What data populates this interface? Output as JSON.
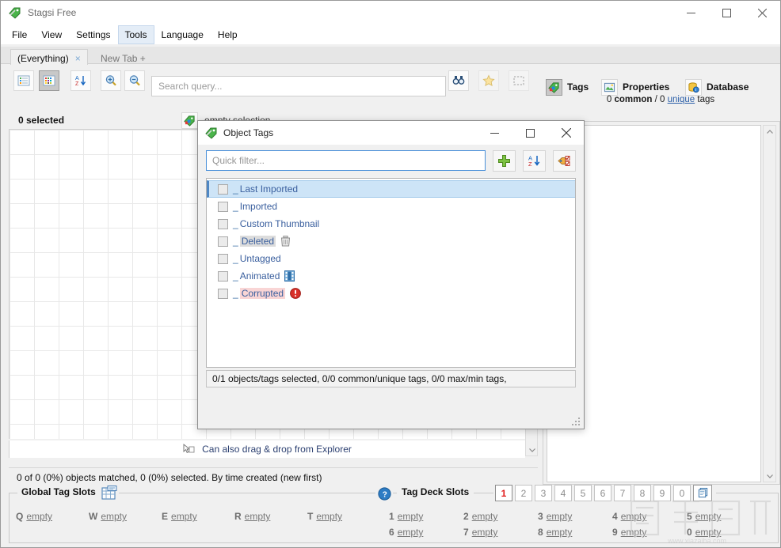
{
  "window": {
    "title": "Stagsi Free",
    "icon": "tag-icon",
    "minimize": "—",
    "maximize": "☐",
    "close": "✕"
  },
  "menubar": {
    "items": [
      {
        "label": "File",
        "active": false
      },
      {
        "label": "View",
        "active": false
      },
      {
        "label": "Settings",
        "active": false
      },
      {
        "label": "Tools",
        "active": true
      },
      {
        "label": "Language",
        "active": false
      },
      {
        "label": "Help",
        "active": false
      }
    ]
  },
  "tabs": {
    "selected": "(Everything)",
    "close_glyph": "×",
    "new_tab": "New Tab +"
  },
  "toolbar": {
    "buttons": [
      {
        "name": "list-view-icon",
        "pressed": false
      },
      {
        "name": "grid-view-icon",
        "pressed": true
      },
      {
        "name": "sort-az-icon",
        "pressed": false
      },
      {
        "name": "zoom-in-icon",
        "pressed": false
      },
      {
        "name": "zoom-out-icon",
        "pressed": false
      }
    ],
    "search_placeholder": "Search query...",
    "search_value": "",
    "binoculars": "find-icon",
    "favorite": "star-icon",
    "select_region": "marquee-icon"
  },
  "right_panel": {
    "tabs": [
      {
        "label": "Tags",
        "icon": "tags-icon",
        "active": true
      },
      {
        "label": "Properties",
        "icon": "properties-icon",
        "active": false
      },
      {
        "label": "Database",
        "icon": "database-icon",
        "active": false
      }
    ],
    "counts": {
      "common_value": "0",
      "common_label": "common",
      "separator": "/",
      "unique_value": "0",
      "unique_label": "unique",
      "suffix": "tags"
    }
  },
  "selection_header": {
    "count": "0 selected",
    "icon": "tags-icon",
    "empty_label": "empty selection"
  },
  "drag_drop": {
    "icon": "drag-drop-icon",
    "label": "Can also drag & drop from Explorer"
  },
  "statusbar": {
    "text": "0 of 0 (0%) objects matched, 0 (0%) selected. By time created (new first)"
  },
  "global_tag_slots": {
    "title": "Global Tag Slots",
    "icon": "slots-grid-icon",
    "slots": [
      {
        "key": "Q",
        "value": "empty"
      },
      {
        "key": "W",
        "value": "empty"
      },
      {
        "key": "E",
        "value": "empty"
      },
      {
        "key": "R",
        "value": "empty"
      },
      {
        "key": "T",
        "value": "empty"
      }
    ]
  },
  "tag_deck_slots": {
    "help_icon": "help-icon",
    "title": "Tag Deck Slots",
    "deck_numbers": [
      "1",
      "2",
      "3",
      "4",
      "5",
      "6",
      "7",
      "8",
      "9",
      "0"
    ],
    "active_deck": "1",
    "deck_copy_icon": "copy-decks-icon",
    "row1": [
      {
        "key": "1",
        "value": "empty"
      },
      {
        "key": "2",
        "value": "empty"
      },
      {
        "key": "3",
        "value": "empty"
      },
      {
        "key": "4",
        "value": "empty"
      },
      {
        "key": "5",
        "value": "empty"
      }
    ],
    "row2": [
      {
        "key": "6",
        "value": "empty"
      },
      {
        "key": "7",
        "value": "empty"
      },
      {
        "key": "8",
        "value": "empty"
      },
      {
        "key": "9",
        "value": "empty"
      },
      {
        "key": "0",
        "value": "empty"
      }
    ]
  },
  "dialog": {
    "title": "Object Tags",
    "icon": "tag-icon",
    "minimize": "—",
    "maximize": "☐",
    "close": "✕",
    "filter_placeholder": "Quick filter...",
    "filter_value": "",
    "buttons": [
      {
        "name": "add-tag-button",
        "icon": "plus-icon"
      },
      {
        "name": "sort-tags-button",
        "icon": "sort-az-icon"
      },
      {
        "name": "tag-options-button",
        "icon": "tag-check-icon"
      }
    ],
    "tags": [
      {
        "prefix": "_",
        "name": "Last Imported",
        "checked": false,
        "selected": true,
        "style": "normal",
        "icon": ""
      },
      {
        "prefix": "_",
        "name": "Imported",
        "checked": false,
        "selected": false,
        "style": "normal",
        "icon": ""
      },
      {
        "prefix": "_",
        "name": "Custom Thumbnail",
        "checked": false,
        "selected": false,
        "style": "normal",
        "icon": ""
      },
      {
        "prefix": "_",
        "name": "Deleted",
        "checked": false,
        "selected": false,
        "style": "dim",
        "icon": "trash-icon"
      },
      {
        "prefix": "_",
        "name": "Untagged",
        "checked": false,
        "selected": false,
        "style": "normal",
        "icon": ""
      },
      {
        "prefix": "_",
        "name": "Animated",
        "checked": false,
        "selected": false,
        "style": "normal",
        "icon": "film-icon"
      },
      {
        "prefix": "_",
        "name": "Corrupted",
        "checked": false,
        "selected": false,
        "style": "err",
        "icon": "error-icon"
      }
    ],
    "status": "0/1 objects/tags selected, 0/0 common/unique tags, 0/0 max/min tags,"
  },
  "watermark": {
    "url": "www.xiazaiba.com"
  },
  "colors": {
    "accent_blue": "#4f87c4",
    "selection_bg": "#cde4f7",
    "active_red": "#e01b1b",
    "link_blue": "#2b5fa8",
    "chrome_bg": "#f0f0f0"
  }
}
